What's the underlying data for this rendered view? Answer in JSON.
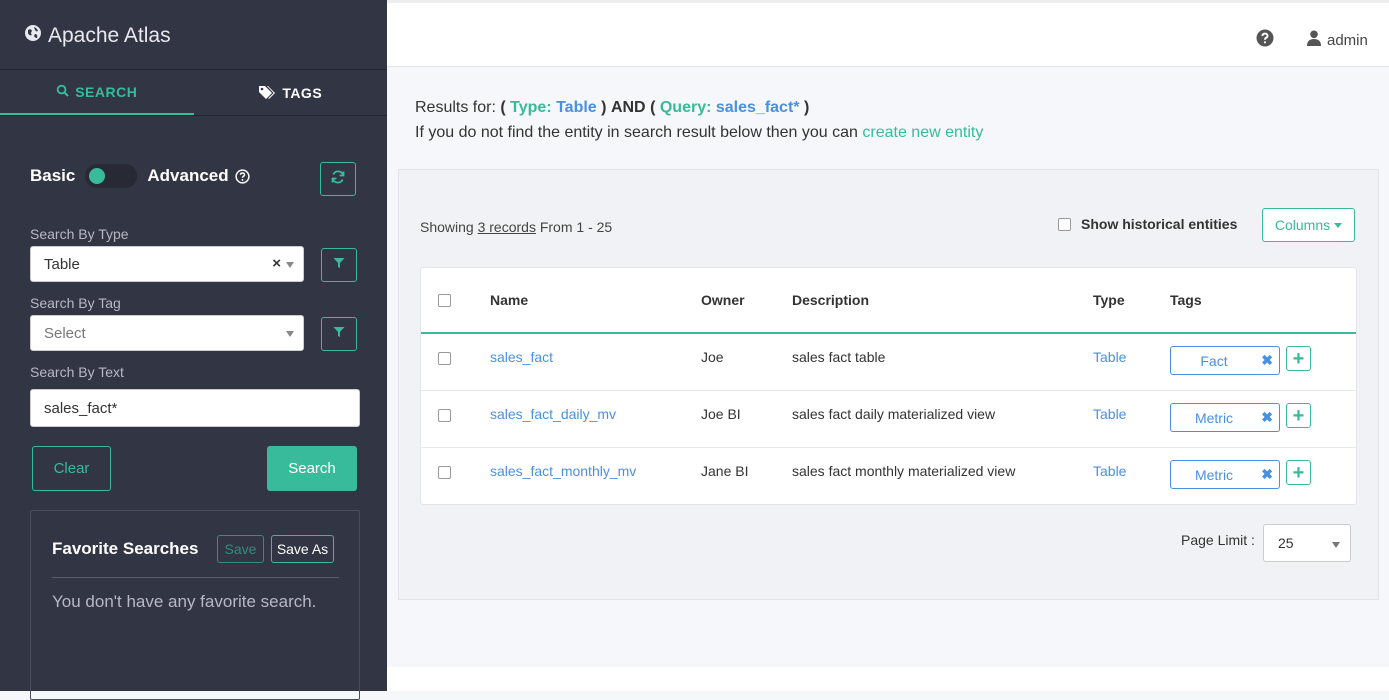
{
  "app": {
    "title": "Apache Atlas"
  },
  "tabs": [
    {
      "label": "SEARCH",
      "icon": "search-icon"
    },
    {
      "label": "TAGS",
      "icon": "tags-icon"
    }
  ],
  "search_mode": {
    "basic_label": "Basic",
    "advanced_label": "Advanced",
    "help_icon": "question-circle-icon"
  },
  "fields": {
    "type_label": "Search By Type",
    "type_value": "Table",
    "type_clear": "×",
    "tag_label": "Search By Tag",
    "tag_placeholder": "Select",
    "text_label": "Search By Text",
    "text_value": "sales_fact*"
  },
  "buttons": {
    "clear": "Clear",
    "search": "Search"
  },
  "favorites": {
    "title": "Favorite Searches",
    "save": "Save",
    "save_as": "Save As",
    "empty": "You don't have any favorite search."
  },
  "header": {
    "user": "admin"
  },
  "results": {
    "prefix": "Results for:",
    "open1": "(",
    "type_key": "Type:",
    "type_val": "Table",
    "close1": ")",
    "and": "AND",
    "open2": "(",
    "query_key": "Query:",
    "query_val": "sales_fact*",
    "close2": ")",
    "create_text": "If you do not find the entity in search result below then you can",
    "create_link": "create new entity"
  },
  "listing": {
    "showing_prefix": "Showing",
    "records": "3 records",
    "range": "From 1 - 25",
    "historical": "Show historical entities",
    "columns": "Columns"
  },
  "table": {
    "headers": [
      "Name",
      "Owner",
      "Description",
      "Type",
      "Tags"
    ],
    "rows": [
      {
        "name": "sales_fact",
        "owner": "Joe",
        "description": "sales fact table",
        "type": "Table",
        "tag": "Fact"
      },
      {
        "name": "sales_fact_daily_mv",
        "owner": "Joe BI",
        "description": "sales fact daily materialized view",
        "type": "Table",
        "tag": "Metric"
      },
      {
        "name": "sales_fact_monthly_mv",
        "owner": "Jane BI",
        "description": "sales fact monthly materialized view",
        "type": "Table",
        "tag": "Metric"
      }
    ],
    "tag_remove": "✖",
    "tag_add": "+"
  },
  "pagination": {
    "label": "Page Limit :",
    "value": "25"
  },
  "colors": {
    "accent": "#37bb9b",
    "link": "#4a90e2",
    "sidebar": "#323544"
  }
}
